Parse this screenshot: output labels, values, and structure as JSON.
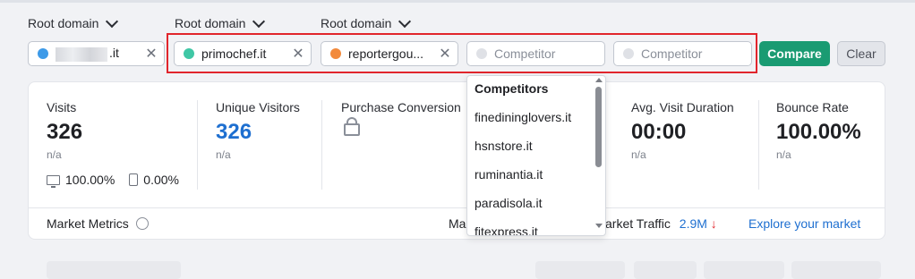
{
  "labels": {
    "root_domain_1": "Root domain",
    "root_domain_2": "Root domain",
    "root_domain_3": "Root domain"
  },
  "fields": [
    {
      "value": ".it",
      "color": "#3d9ae8"
    },
    {
      "value": "primochef.it",
      "color": "#3fc7a5"
    },
    {
      "value": "reportergou...",
      "color": "#f28a3c"
    },
    {
      "placeholder": "Competitor",
      "color": "#dfe1e6"
    },
    {
      "placeholder": "Competitor",
      "color": "#dfe1e6"
    }
  ],
  "buttons": {
    "compare": "Compare",
    "clear": "Clear"
  },
  "metrics": {
    "visits": {
      "label": "Visits",
      "value": "326",
      "na": "n/a"
    },
    "unique": {
      "label": "Unique Visitors",
      "value": "326",
      "na": "n/a"
    },
    "purchase": {
      "label": "Purchase Conversion"
    },
    "duration": {
      "label": "Avg. Visit Duration",
      "value": "00:00",
      "na": "n/a"
    },
    "bounce": {
      "label": "Bounce Rate",
      "value": "100.00%",
      "na": "n/a"
    }
  },
  "device": {
    "desktop": "100.00%",
    "mobile": "0.00%"
  },
  "bottom": {
    "market_metrics": "Market Metrics",
    "ma": "Ma",
    "market_traffic": "arket Traffic",
    "traffic_value": "2.9M",
    "arrow": "↓",
    "explore": "Explore your market"
  },
  "dropdown": {
    "header": "Competitors",
    "items": [
      "finedininglovers.it",
      "hsnstore.it",
      "ruminantia.it",
      "paradisola.it",
      "fitexpress.it"
    ]
  },
  "colors": {
    "accent": "#1a9b72",
    "highlight": "#e1252c",
    "link": "#1e6fd0"
  }
}
